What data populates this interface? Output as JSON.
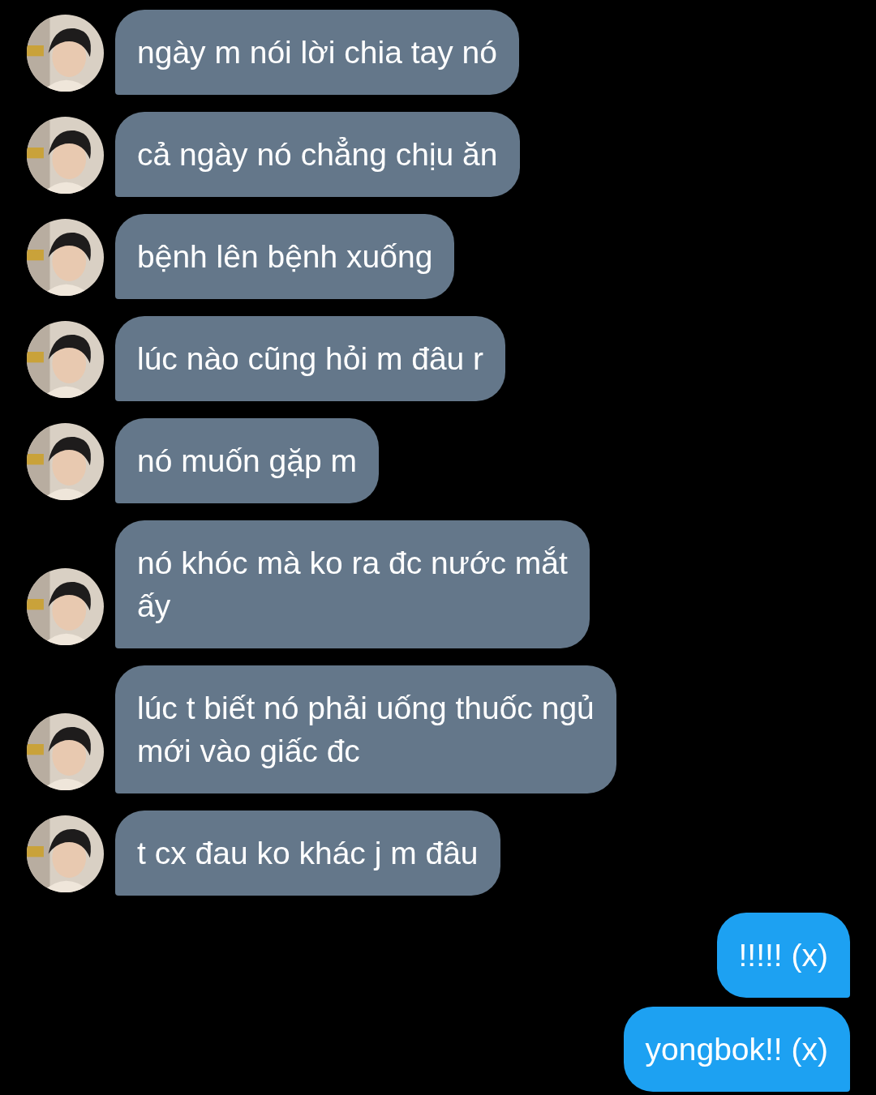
{
  "messages": [
    {
      "kind": "incoming",
      "lines": [
        "ngày m nói lời chia tay nó"
      ]
    },
    {
      "kind": "incoming",
      "lines": [
        "cả ngày nó chẳng chịu ăn"
      ]
    },
    {
      "kind": "incoming",
      "lines": [
        "bệnh lên bệnh xuống"
      ]
    },
    {
      "kind": "incoming",
      "lines": [
        "lúc nào cũng hỏi m đâu r"
      ]
    },
    {
      "kind": "incoming",
      "lines": [
        "nó muốn gặp m"
      ]
    },
    {
      "kind": "incoming",
      "lines": [
        "nó khóc mà ko ra đc nước mắt",
        "ấy"
      ]
    },
    {
      "kind": "incoming",
      "lines": [
        "lúc t biết nó phải uống thuốc ngủ",
        "mới vào giấc đc"
      ]
    },
    {
      "kind": "incoming",
      "lines": [
        "t cx đau ko khác j m đâu"
      ]
    },
    {
      "kind": "outgoing",
      "lines": [
        "!!!!! (x)"
      ]
    },
    {
      "kind": "outgoing",
      "lines": [
        "yongbok!! (x)"
      ]
    }
  ]
}
